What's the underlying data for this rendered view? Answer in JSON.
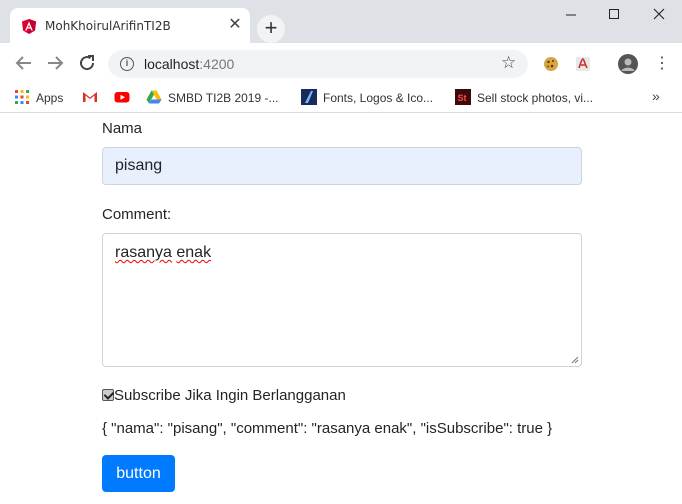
{
  "browser": {
    "tab_title": "MohKhoirulArifinTI2B",
    "tab_close": "✕",
    "new_tab": "+",
    "url_host": "localhost",
    "url_port": ":4200",
    "bookmarks": [
      {
        "label": "Apps",
        "icon": "apps-grid-icon"
      },
      {
        "label": "",
        "icon": "gmail-icon"
      },
      {
        "label": "",
        "icon": "youtube-icon"
      },
      {
        "label": "SMBD TI2B 2019 -...",
        "icon": "google-drive-icon"
      },
      {
        "label": "Fonts, Logos & Ico...",
        "icon": "fonts-site-icon"
      },
      {
        "label": "Sell stock photos, vi...",
        "icon": "adobe-stock-icon"
      }
    ],
    "more_bookmarks": "»"
  },
  "form": {
    "nama_label": "Nama",
    "nama_value": "pisang",
    "comment_label": "Comment:",
    "comment_value_word1": "rasanya",
    "comment_value_word2": "enak",
    "subscribe_label": "Subscribe Jika Ingin Berlangganan",
    "subscribe_checked": true,
    "json_output": "{ \"nama\": \"pisang\", \"comment\": \"rasanya enak\", \"isSubscribe\": true }",
    "button_label": "button"
  },
  "colors": {
    "primary_button": "#007bff",
    "autofill_bg": "#e8f0fe",
    "angular_red": "#dd0031"
  }
}
